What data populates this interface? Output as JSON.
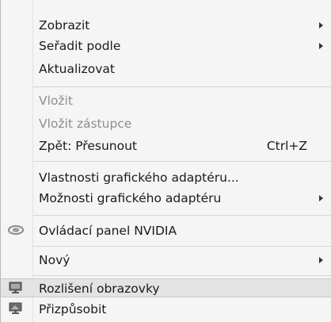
{
  "menu": {
    "items": [
      {
        "label": "Zobrazit"
      },
      {
        "label": "Seřadit podle"
      },
      {
        "label": "Aktualizovat"
      },
      {
        "label": "Vložit"
      },
      {
        "label": "Vložit zástupce"
      },
      {
        "label": "Zpět: Přesunout",
        "shortcut": "Ctrl+Z"
      },
      {
        "label": "Vlastnosti grafického adaptéru..."
      },
      {
        "label": "Možnosti grafického adaptéru"
      },
      {
        "label": "Ovládací panel NVIDIA",
        "icon": "nvidia-icon"
      },
      {
        "label": "Nový"
      },
      {
        "label": "Rozlišení obrazovky",
        "icon": "screen-resolution-icon"
      },
      {
        "label": "Přizpůsobit",
        "icon": "personalize-icon"
      }
    ]
  }
}
